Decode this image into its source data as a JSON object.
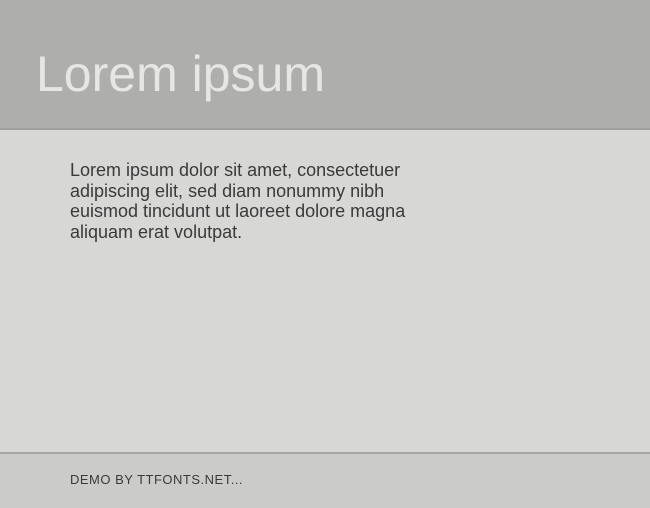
{
  "header": {
    "title": "Lorem ipsum"
  },
  "main": {
    "body_text": "Lorem ipsum dolor sit amet, consectetuer adipiscing elit, sed diam nonummy nibh euismod tincidunt ut laoreet dolore magna aliquam erat volutpat."
  },
  "footer": {
    "text": "DEMO BY TTFONTS.NET..."
  }
}
